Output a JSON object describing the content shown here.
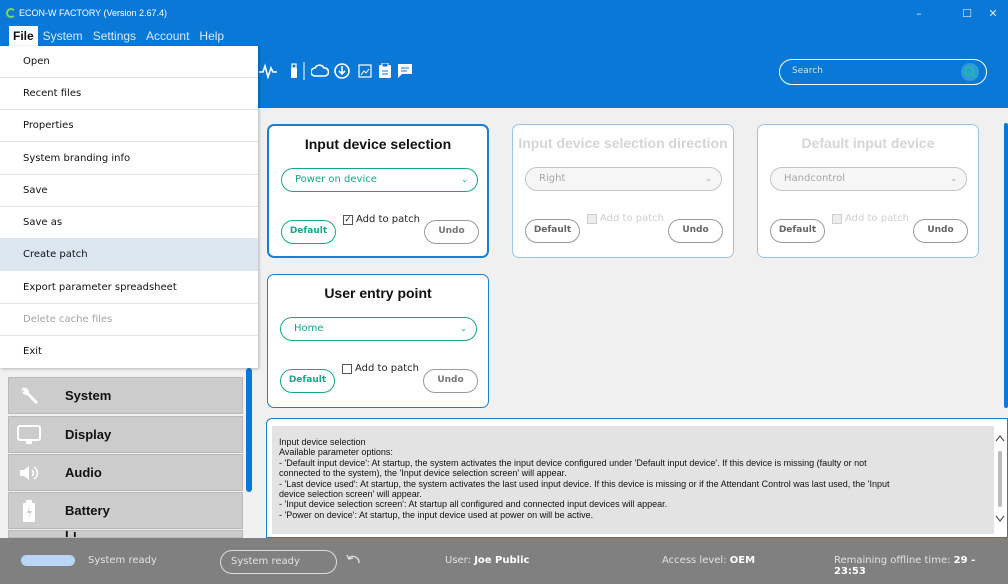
{
  "app": {
    "title": "ECON-W FACTORY (Version 2.67.4)",
    "window_controls": [
      "–",
      "☐",
      "✕"
    ]
  },
  "menubar": {
    "items": [
      "File",
      "System",
      "Settings",
      "Account",
      "Help"
    ]
  },
  "file_menu": {
    "items": [
      {
        "label": "Open",
        "state": "normal"
      },
      {
        "label": "Recent files",
        "state": "normal"
      },
      {
        "label": "Properties",
        "state": "normal"
      },
      {
        "label": "System branding info",
        "state": "normal"
      },
      {
        "label": "Save",
        "state": "normal"
      },
      {
        "label": "Save as",
        "state": "normal"
      },
      {
        "label": "Create patch",
        "state": "highlighted"
      },
      {
        "label": "Export parameter spreadsheet",
        "state": "normal"
      },
      {
        "label": "Delete cache files",
        "state": "disabled"
      },
      {
        "label": "Exit",
        "state": "normal"
      }
    ]
  },
  "toolbar": {
    "icons": [
      "pulse-icon",
      "usb-stick-icon",
      "cloud-icon",
      "download-icon",
      "image-icon",
      "clipboard-icon",
      "message-icon"
    ],
    "search_placeholder": "Search"
  },
  "cards": {
    "input_device_selection": {
      "title": "Input device selection",
      "value": "Power on device",
      "add_to_patch": "Add to patch",
      "checked": true,
      "default_label": "Default",
      "undo_label": "Undo"
    },
    "input_device_selection_direction": {
      "title": "Input device selection direction",
      "value": "Right",
      "add_to_patch": "Add to patch",
      "checked": false,
      "default_label": "Default",
      "undo_label": "Undo"
    },
    "default_input_device": {
      "title": "Default input device",
      "value": "Handcontrol",
      "add_to_patch": "Add to patch",
      "checked": false,
      "default_label": "Default",
      "undo_label": "Undo"
    },
    "user_entry_point": {
      "title": "User entry point",
      "value": "Home",
      "add_to_patch": "Add to patch",
      "checked": false,
      "default_label": "Default",
      "undo_label": "Undo"
    }
  },
  "info": {
    "lines": [
      "Input device selection",
      "Available parameter options:",
      "- 'Default input device': At startup, the system activates the input device configured under 'Default input device'. If this device is missing (faulty or not",
      "connected to the system), the 'Input device selection screen' will appear.",
      "- 'Last device used': At startup, the system activates the last used input device. If this device is missing or if the Attendant Control was last used, the 'Input",
      "device selection screen' will appear.",
      "- 'Input device selection screen': At startup all configured and connected input devices will appear.",
      "- 'Power on device': At startup, the input device used at power on will be active."
    ]
  },
  "sidebar": {
    "items": [
      {
        "label": "System",
        "icon": "wrench-icon"
      },
      {
        "label": "Display",
        "icon": "monitor-icon"
      },
      {
        "label": "Audio",
        "icon": "speaker-icon"
      },
      {
        "label": "Battery",
        "icon": "battery-icon"
      },
      {
        "label": "Li...",
        "icon": "light-icon"
      }
    ]
  },
  "statusbar": {
    "status_left": "System ready",
    "status_box": "System ready",
    "user_label": "User:",
    "user_value": "Joe Public",
    "access_label": "Access level:",
    "access_value": "OEM",
    "offline_label": "Remaining offline time:",
    "offline_value": "29 - 23:53"
  }
}
